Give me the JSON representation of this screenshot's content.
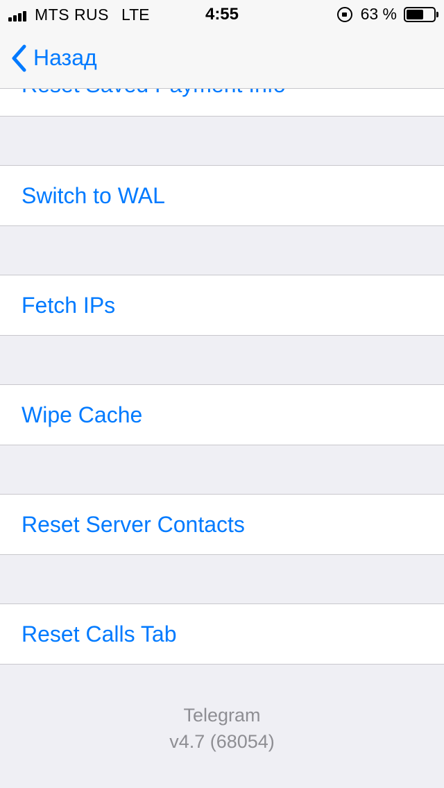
{
  "status_bar": {
    "carrier": "MTS RUS",
    "network": "LTE",
    "time": "4:55",
    "battery_percent_text": "63 %",
    "battery_level": 0.63
  },
  "nav": {
    "back_label": "Назад"
  },
  "cells": [
    {
      "label": "Reset Saved Payment Info"
    },
    {
      "label": "Switch to WAL"
    },
    {
      "label": "Fetch IPs"
    },
    {
      "label": "Wipe Cache"
    },
    {
      "label": "Reset Server Contacts"
    },
    {
      "label": "Reset Calls Tab"
    }
  ],
  "footer": {
    "app_name": "Telegram",
    "version": "v4.7 (68054)"
  },
  "colors": {
    "accent": "#007aff",
    "background": "#efeff4",
    "secondary_text": "#8e8e93"
  }
}
